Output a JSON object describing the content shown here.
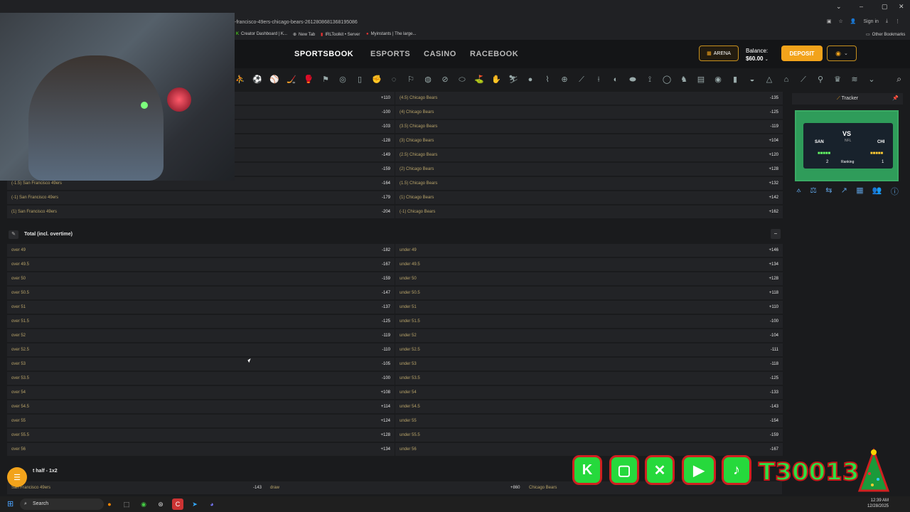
{
  "browser": {
    "url": "-francisco-49ers-chicago-bears-2612808681368195086",
    "signin": "Sign in",
    "bookmarks": [
      "Creator Dashboard | K...",
      "New Tab",
      "IRLToolkit • Server",
      "Myinstants | The large..."
    ],
    "other_bookmarks": "Other Bookmarks"
  },
  "header": {
    "nav": [
      "SPORTSBOOK",
      "ESPORTS",
      "CASINO",
      "RACEBOOK"
    ],
    "arena_label": "ARENA",
    "balance_label": "Balance:",
    "balance_value": "$60.00",
    "deposit_label": "DEPOSIT"
  },
  "spread_rows": [
    {
      "left_name": "",
      "left_odd": "+110",
      "right_name": "(4.5) Chicago Bears",
      "right_odd": "-135"
    },
    {
      "left_name": "",
      "left_odd": "-100",
      "right_name": "(4) Chicago Bears",
      "right_odd": "-125"
    },
    {
      "left_name": "",
      "left_odd": "-103",
      "right_name": "(3.5) Chicago Bears",
      "right_odd": "-119"
    },
    {
      "left_name": "",
      "left_odd": "-128",
      "right_name": "(3) Chicago Bears",
      "right_odd": "+104"
    },
    {
      "left_name": "",
      "left_odd": "-149",
      "right_name": "(2.5) Chicago Bears",
      "right_odd": "+120"
    },
    {
      "left_name": "",
      "left_odd": "-159",
      "right_name": "(2) Chicago Bears",
      "right_odd": "+128"
    },
    {
      "left_name": "(-1.5) San Francisco 49ers",
      "left_odd": "-164",
      "right_name": "(1.5) Chicago Bears",
      "right_odd": "+132"
    },
    {
      "left_name": "(-1) San Francisco 49ers",
      "left_odd": "-179",
      "right_name": "(1) Chicago Bears",
      "right_odd": "+142"
    },
    {
      "left_name": "(1) San Francisco 49ers",
      "left_odd": "-204",
      "right_name": "(-1) Chicago Bears",
      "right_odd": "+162"
    }
  ],
  "total_section": {
    "title": "Total (incl. overtime)",
    "rows": [
      {
        "left_name": "over 49",
        "left_odd": "-182",
        "right_name": "under 49",
        "right_odd": "+146"
      },
      {
        "left_name": "over 49.5",
        "left_odd": "-167",
        "right_name": "under 49.5",
        "right_odd": "+134"
      },
      {
        "left_name": "over 50",
        "left_odd": "-159",
        "right_name": "under 50",
        "right_odd": "+128"
      },
      {
        "left_name": "over 50.5",
        "left_odd": "-147",
        "right_name": "under 50.5",
        "right_odd": "+118"
      },
      {
        "left_name": "over 51",
        "left_odd": "-137",
        "right_name": "under 51",
        "right_odd": "+110"
      },
      {
        "left_name": "over 51.5",
        "left_odd": "-125",
        "right_name": "under 51.5",
        "right_odd": "-100"
      },
      {
        "left_name": "over 52",
        "left_odd": "-119",
        "right_name": "under 52",
        "right_odd": "-104"
      },
      {
        "left_name": "over 52.5",
        "left_odd": "-110",
        "right_name": "under 52.5",
        "right_odd": "-111"
      },
      {
        "left_name": "over 53",
        "left_odd": "-105",
        "right_name": "under 53",
        "right_odd": "-118"
      },
      {
        "left_name": "over 53.5",
        "left_odd": "-100",
        "right_name": "under 53.5",
        "right_odd": "-125"
      },
      {
        "left_name": "over 54",
        "left_odd": "+108",
        "right_name": "under 54",
        "right_odd": "-133"
      },
      {
        "left_name": "over 54.5",
        "left_odd": "+114",
        "right_name": "under 54.5",
        "right_odd": "-143"
      },
      {
        "left_name": "over 55",
        "left_odd": "+124",
        "right_name": "under 55",
        "right_odd": "-154"
      },
      {
        "left_name": "over 55.5",
        "left_odd": "+128",
        "right_name": "under 55.5",
        "right_odd": "-159"
      },
      {
        "left_name": "over 56",
        "left_odd": "+134",
        "right_name": "under 56",
        "right_odd": "-167"
      }
    ]
  },
  "half_section": {
    "title": "t half - 1x2",
    "home": "San Francisco 49ers",
    "home_odd": "-143",
    "draw": "draw",
    "draw_odd": "+860",
    "away": "Chicago Bears"
  },
  "tracker": {
    "title": "Tracker",
    "home": "SAN",
    "away": "CHI",
    "vs": "VS",
    "league": "NFL",
    "ranking_label": "Ranking",
    "home_rank": "2",
    "away_rank": "1"
  },
  "socials": {
    "handle": "T30013"
  },
  "taskbar": {
    "search": "Search",
    "time": "12:39 AM",
    "date": "12/28/2025"
  }
}
